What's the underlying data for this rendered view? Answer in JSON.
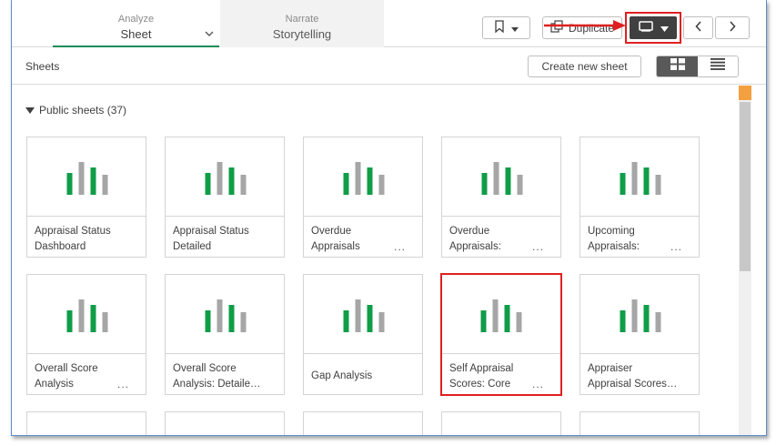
{
  "topbar": {
    "analyze": {
      "small": "Analyze",
      "big": "Sheet"
    },
    "narrate": {
      "small": "Narrate",
      "big": "Storytelling"
    },
    "duplicate_label": "Duplicate"
  },
  "panel": {
    "title": "Sheets",
    "create_label": "Create new sheet"
  },
  "section": {
    "label": "Public sheets (37)"
  },
  "cards": [
    {
      "line1": "Appraisal Status",
      "line2": "Dashboard",
      "dots": ""
    },
    {
      "line1": "Appraisal Status",
      "line2": "Detailed",
      "dots": ""
    },
    {
      "line1": "Overdue",
      "line2": "Appraisals",
      "dots": "..."
    },
    {
      "line1": "Overdue",
      "line2": "Appraisals:",
      "dots": "..."
    },
    {
      "line1": "Upcoming",
      "line2": "Appraisals:",
      "dots": "..."
    },
    {
      "line1": "Overall Score",
      "line2": "Analysis",
      "dots": "..."
    },
    {
      "line1": "Overall Score",
      "line2": "Analysis: Detaile…",
      "dots": ""
    },
    {
      "line1": "Gap Analysis",
      "line2": "",
      "dots": ""
    },
    {
      "line1": "Self Appraisal",
      "line2": "Scores: Core",
      "dots": "..."
    },
    {
      "line1": "Appraiser",
      "line2": "Appraisal Scores…",
      "dots": ""
    }
  ],
  "colors": {
    "accent_green": "#0f9d48",
    "bar_gray": "#a6a6a6",
    "highlight_red": "#e02020"
  }
}
